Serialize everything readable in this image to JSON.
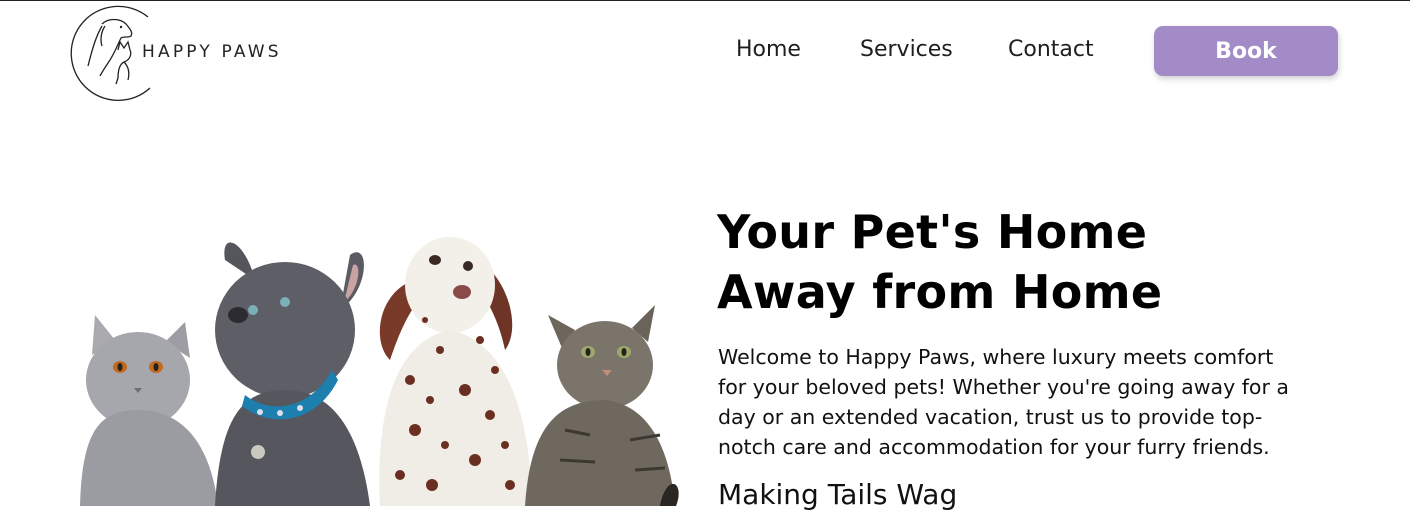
{
  "theme": {
    "accent": "#a38bc8"
  },
  "brand": {
    "name": "HAPPY PAWS",
    "logo_icon": "dog-cat-circle-logo"
  },
  "nav": {
    "items": [
      {
        "label": "Home"
      },
      {
        "label": "Services"
      },
      {
        "label": "Contact"
      }
    ],
    "cta_label": "Book"
  },
  "hero": {
    "title_lines": [
      "Your Pet's Home",
      "Away from Home"
    ],
    "intro_lines": [
      "Welcome to Happy Paws, where luxury meets comfort",
      "for your beloved pets! Whether you're going away for a",
      "day or an extended vacation, trust us to provide top-",
      "notch care and accommodation for your furry friends."
    ],
    "subheading": "Making Tails Wag",
    "image_subject": "two cats and two dogs"
  }
}
